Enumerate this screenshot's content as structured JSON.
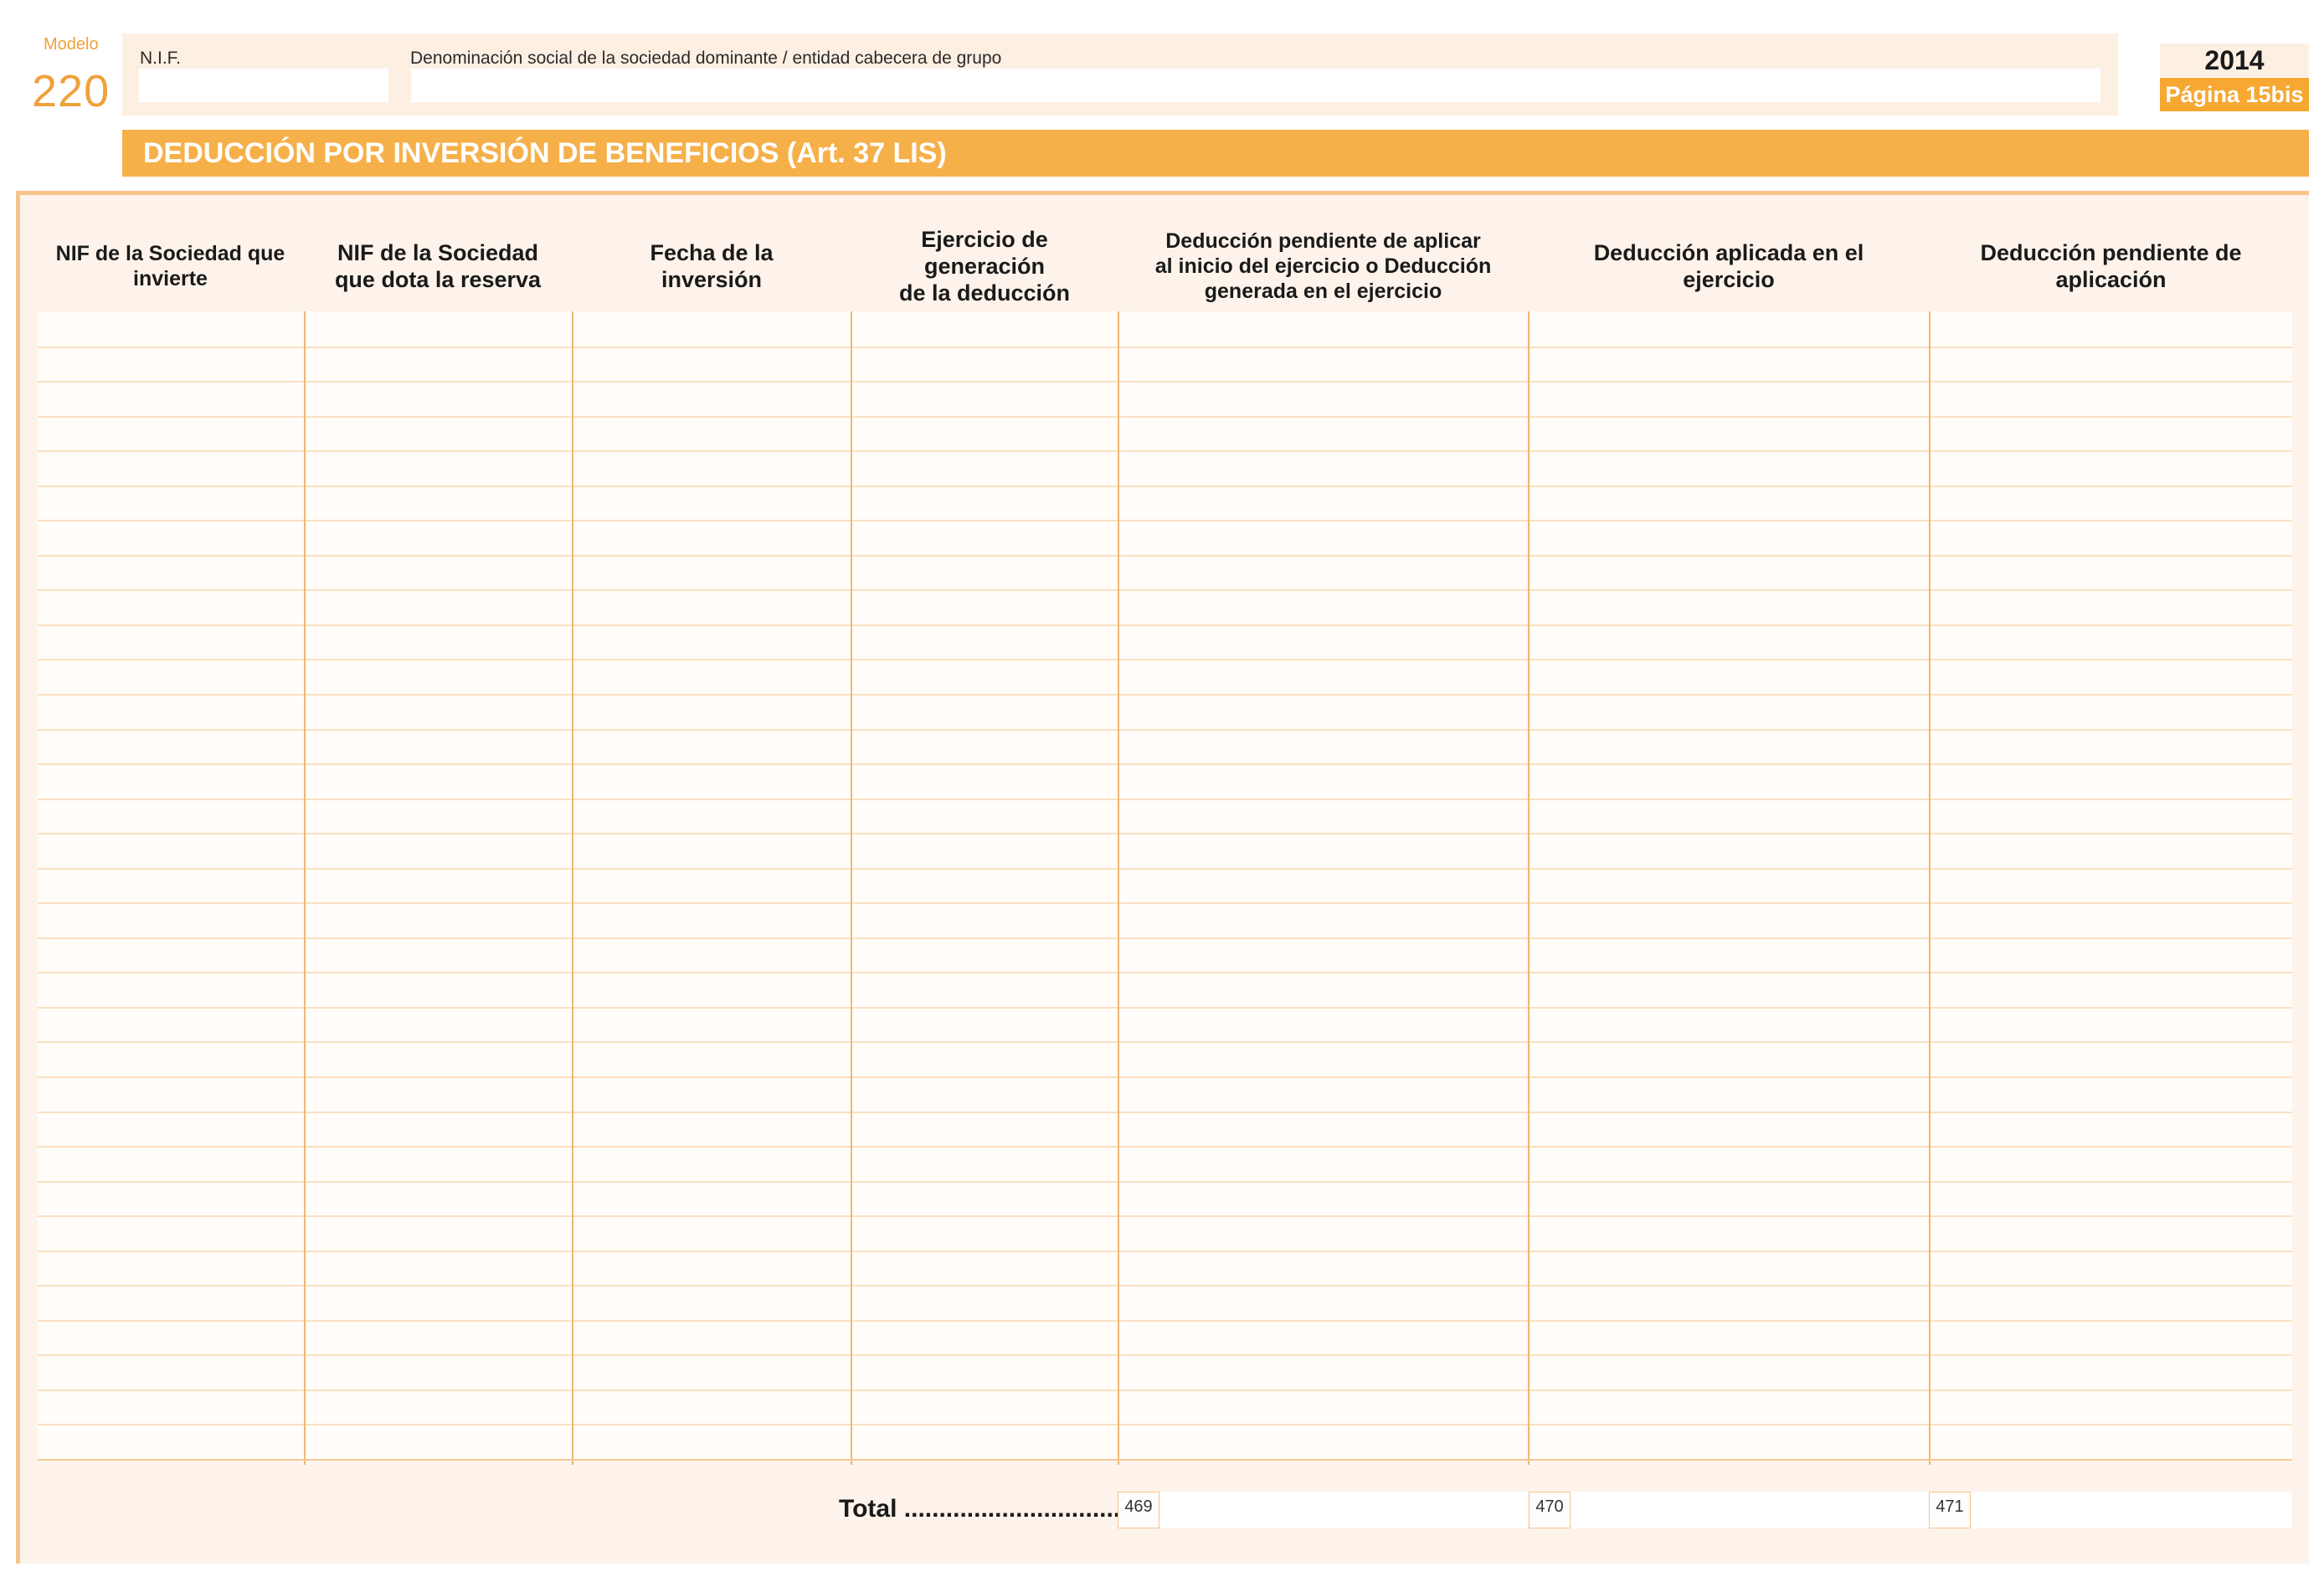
{
  "header": {
    "modelo_label": "Modelo",
    "modelo_number": "220",
    "nif_label": "N.I.F.",
    "denominacion_label": "Denominación social de la sociedad dominante / entidad cabecera de grupo",
    "nif_value": "",
    "denominacion_value": "",
    "year": "2014",
    "page": "Página 15bis"
  },
  "section": {
    "title": "DEDUCCIÓN POR INVERSIÓN DE BENEFICIOS (Art. 37 LIS)"
  },
  "table": {
    "columns": [
      "NIF de la Sociedad que\ninvierte",
      "NIF de la Sociedad\nque dota la reserva",
      "Fecha de la\ninversión",
      "Ejercicio de\ngeneración\nde la deducción",
      "Deducción pendiente de aplicar\nal inicio del ejercicio o Deducción\ngenerada en el ejercicio",
      "Deducción aplicada en el\nejercicio",
      "Deducción pendiente de\naplicación"
    ],
    "row_count": 33
  },
  "totals": {
    "label": "Total ...............................",
    "boxes": [
      {
        "code": "469",
        "value": ""
      },
      {
        "code": "470",
        "value": ""
      },
      {
        "code": "471",
        "value": ""
      }
    ]
  },
  "colors": {
    "accent": "#f6a832",
    "section_bar": "#f6b04a",
    "panel": "#fdf0e3",
    "frame": "#fdf3ea",
    "grid_line": "#f0b86e"
  }
}
